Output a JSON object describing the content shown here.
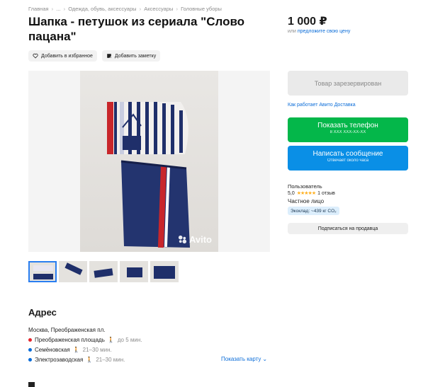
{
  "breadcrumb": [
    "Главная",
    "...",
    "Одежда, обувь, аксессуары",
    "Аксессуары",
    "Головные уборы"
  ],
  "breadcrumb_sep": "›",
  "title": "Шапка - петушок из сериала \"Слово пацана\"",
  "actions": {
    "favorite": "Добавить в избранное",
    "note": "Добавить заметку"
  },
  "watermark": "Avito",
  "price": "1 000 ₽",
  "price_sub": {
    "prefix": "или",
    "link": "предложите свою цену"
  },
  "reserved_label": "Товар зарезервирован",
  "delivery_link": "Как работает Авито Доставка",
  "phone_button": {
    "label": "Показать телефон",
    "sub": "8 XXX XXX-XX-XX"
  },
  "message_button": {
    "label": "Написать сообщение",
    "sub": "Отвечает около часа"
  },
  "seller": {
    "role": "Пользователь",
    "rating": "5,0",
    "stars": "★★★★★",
    "reviews": "1 отзыв",
    "type": "Частное лицо",
    "eco": "Экоклад: ~439 кг CO₂"
  },
  "subscribe_label": "Подписаться на продавца",
  "address": {
    "heading": "Адрес",
    "line": "Москва, Преображенская пл.",
    "metro": [
      {
        "name": "Преображенская площадь",
        "time": "до 5 мин.",
        "color": "#e4262d"
      },
      {
        "name": "Семёновская",
        "time": "21–30 мин.",
        "color": "#0a6cd8"
      },
      {
        "name": "Электрозаводская",
        "time": "21–30 мин.",
        "color": "#0a6cd8"
      }
    ],
    "show_map": "Показать карту"
  },
  "colors": {
    "green": "#04b74a",
    "blue": "#0a8fe6",
    "link": "#0a6cd8"
  }
}
